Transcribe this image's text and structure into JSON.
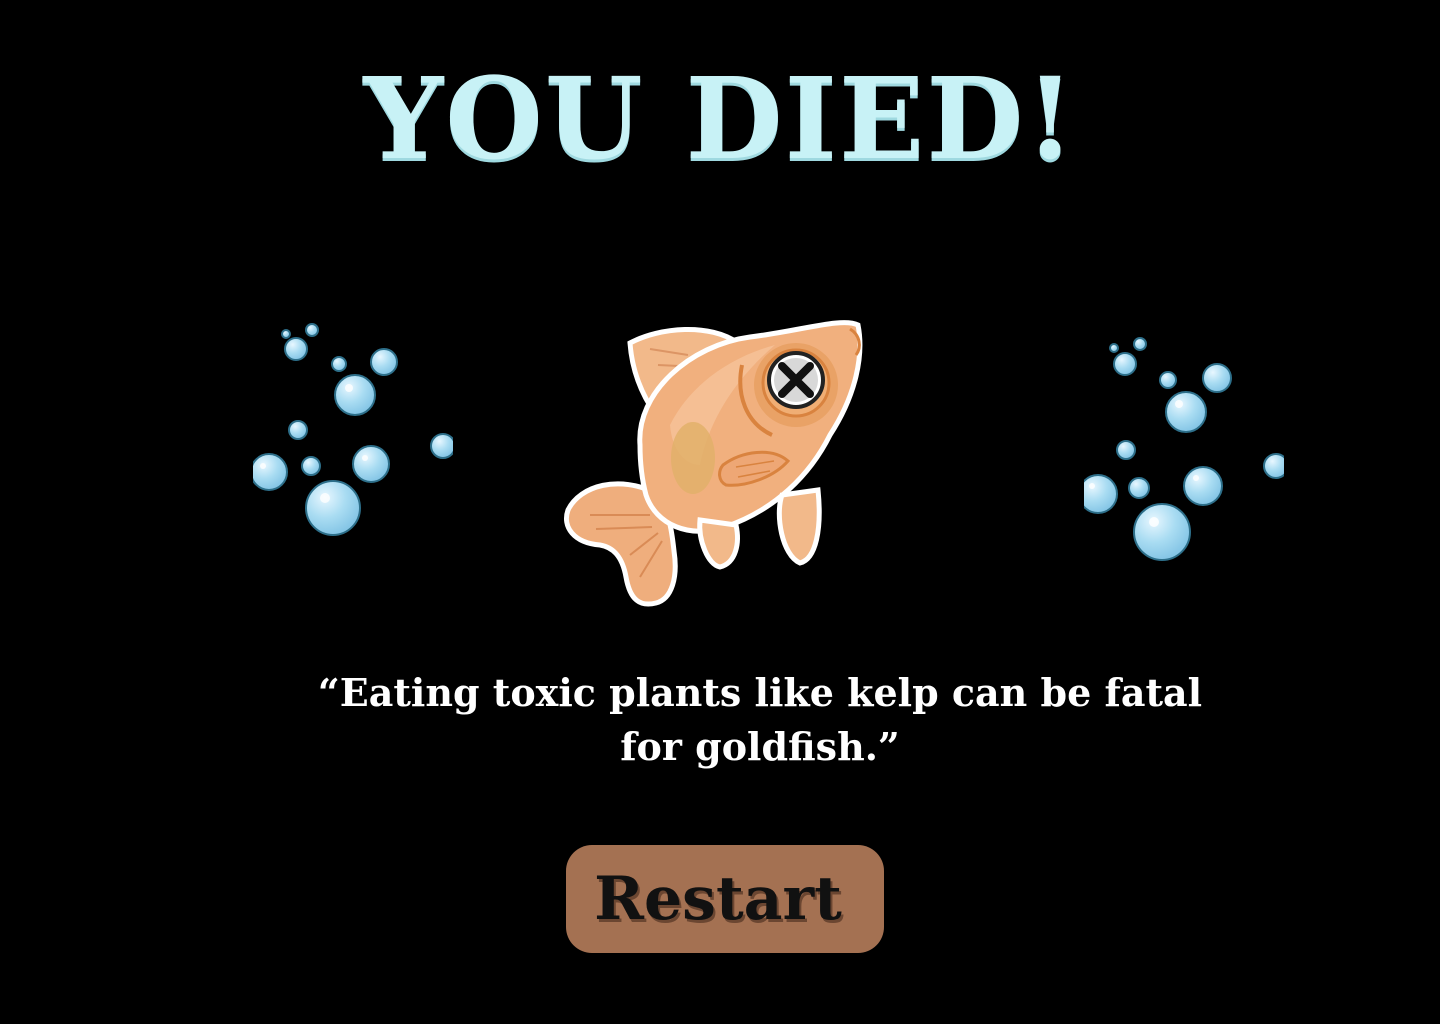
{
  "title": "YOU DIED!",
  "message": "“Eating toxic plants like kelp can be fatal for goldfish.”",
  "restart_button": {
    "label": "Restart"
  },
  "icons": {
    "left_bubbles": "bubbles-icon",
    "right_bubbles": "bubbles-icon",
    "fish": "dead-goldfish-icon"
  },
  "colors": {
    "background": "#000000",
    "title": "#c8f2f6",
    "message": "#ffffff",
    "button": "#a47152",
    "button_text": "#111111",
    "bubble": "#a9dcf2",
    "fish": "#f1b07e"
  }
}
